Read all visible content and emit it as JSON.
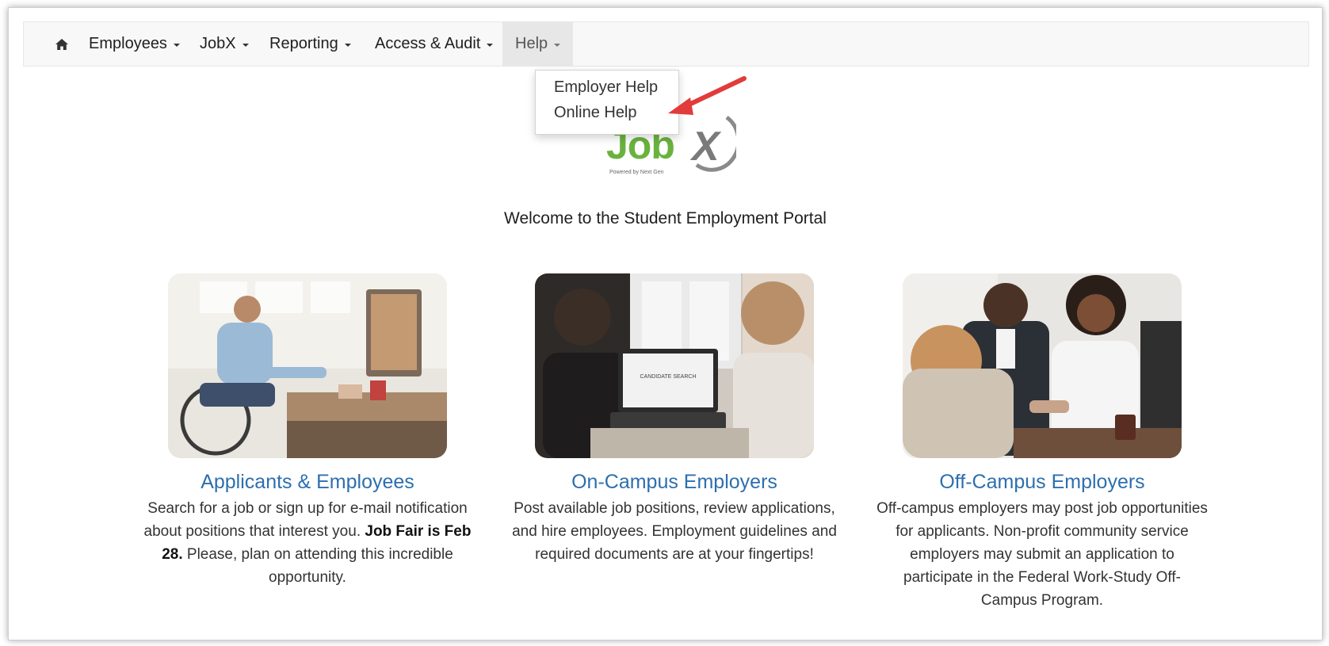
{
  "nav": {
    "items": [
      {
        "label": "Employees"
      },
      {
        "label": "JobX"
      },
      {
        "label": "Reporting"
      },
      {
        "label": "Access & Audit"
      },
      {
        "label": "Help"
      }
    ],
    "active_item": "Help",
    "home_icon": "home-icon"
  },
  "help_menu": {
    "items": [
      {
        "label": "Employer Help"
      },
      {
        "label": "Online Help"
      }
    ],
    "highlighted": "Online Help"
  },
  "logo": {
    "text": "Job",
    "x_letter": "X",
    "tagline": "Powered by Next Gen"
  },
  "welcome": "Welcome to the Student Employment Portal",
  "cards": [
    {
      "title": "Applicants & Employees",
      "desc_before": "Search for a job or sign up for e-mail notification about positions that interest you.",
      "desc_bold": "Job Fair is Feb 28.",
      "desc_after": "Please, plan on attending this incredible opportunity.",
      "image": "person-in-wheelchair-at-office-desk-photo"
    },
    {
      "title": "On-Campus Employers",
      "desc": "Post available job positions, review applications, and hire employees. Employment guidelines and required documents are at your fingertips!",
      "screen_text": "CANDIDATE SEARCH",
      "image": "two-people-at-laptop-photo"
    },
    {
      "title": "Off-Campus Employers",
      "desc": "Off-campus employers may post job opportunities for applicants. Non-profit community service employers may submit an application to participate in the Federal Work-Study Off-Campus Program.",
      "image": "business-meeting-handshake-photo"
    }
  ],
  "colors": {
    "link_blue": "#2d6fae",
    "logo_green": "#6ab23e",
    "arrow_red": "#e23b3b",
    "navbar_bg": "#f8f8f8",
    "active_tab_bg": "#e7e7e7"
  }
}
